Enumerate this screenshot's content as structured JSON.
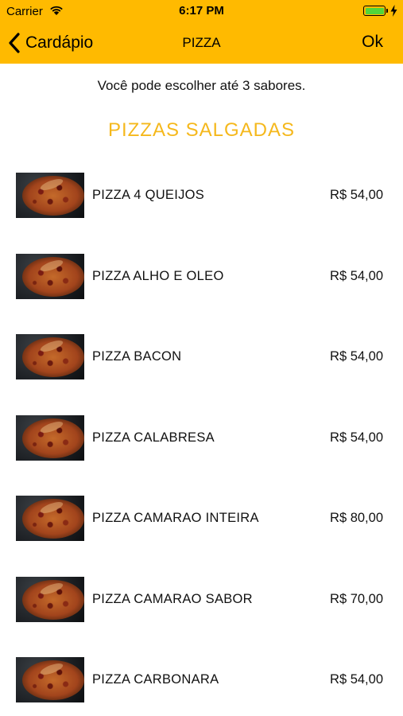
{
  "status": {
    "carrier": "Carrier",
    "time": "6:17 PM"
  },
  "nav": {
    "back_label": "Cardápio",
    "title": "PIZZA",
    "ok_label": "Ok"
  },
  "hint": "Você pode escolher até 3 sabores.",
  "section_title": "PIZZAS SALGADAS",
  "colors": {
    "accent": "#FFBA00",
    "section_title": "#F5B81C",
    "battery": "#52D63A"
  },
  "items": [
    {
      "name": "PIZZA 4 QUEIJOS",
      "price": "R$ 54,00"
    },
    {
      "name": "PIZZA ALHO E OLEO",
      "price": "R$ 54,00"
    },
    {
      "name": "PIZZA BACON",
      "price": "R$ 54,00"
    },
    {
      "name": "PIZZA CALABRESA",
      "price": "R$ 54,00"
    },
    {
      "name": "PIZZA CAMARAO INTEIRA",
      "price": "R$ 80,00"
    },
    {
      "name": "PIZZA CAMARAO SABOR",
      "price": "R$ 70,00"
    },
    {
      "name": "PIZZA CARBONARA",
      "price": "R$ 54,00"
    }
  ]
}
